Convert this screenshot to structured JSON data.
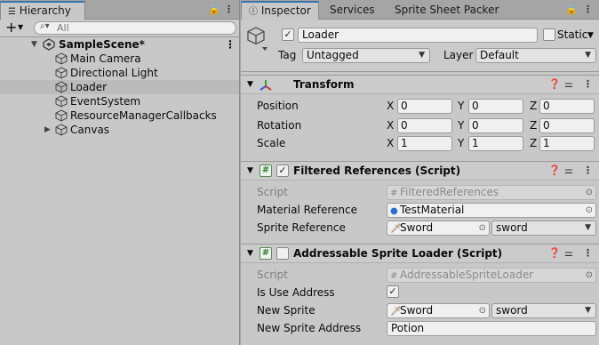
{
  "hierarchy": {
    "tab_label": "Hierarchy",
    "search_placeholder": "All",
    "scene": "SampleScene*",
    "items": [
      {
        "label": "Main Camera"
      },
      {
        "label": "Directional Light"
      },
      {
        "label": "Loader",
        "selected": true
      },
      {
        "label": "EventSystem"
      },
      {
        "label": "ResourceManagerCallbacks"
      },
      {
        "label": "Canvas",
        "collapsed": true
      }
    ]
  },
  "inspector": {
    "tabs": [
      "Inspector",
      "Services",
      "Sprite Sheet Packer"
    ],
    "object": {
      "name": "Loader",
      "active": true,
      "static_label": "Static",
      "tag_label": "Tag",
      "tag_value": "Untagged",
      "layer_label": "Layer",
      "layer_value": "Default"
    },
    "transform": {
      "title": "Transform",
      "rows": [
        {
          "label": "Position",
          "x": "0",
          "y": "0",
          "z": "0"
        },
        {
          "label": "Rotation",
          "x": "0",
          "y": "0",
          "z": "0"
        },
        {
          "label": "Scale",
          "x": "1",
          "y": "1",
          "z": "1"
        }
      ],
      "axis": [
        "X",
        "Y",
        "Z"
      ]
    },
    "filtered": {
      "title": "Filtered References (Script)",
      "script_label": "Script",
      "script_value": "FilteredReferences",
      "material_label": "Material Reference",
      "material_value": "TestMaterial",
      "sprite_label": "Sprite Reference",
      "sprite_value": "Sword",
      "sprite_sub": "sword"
    },
    "addressable": {
      "title": "Addressable Sprite Loader (Script)",
      "script_label": "Script",
      "script_value": "AddressableSpriteLoader",
      "use_address_label": "Is Use Address",
      "use_address": true,
      "new_sprite_label": "New Sprite",
      "new_sprite_value": "Sword",
      "new_sprite_sub": "sword",
      "address_label": "New Sprite Address",
      "address_value": "Potion"
    }
  },
  "colors": {
    "panel": "#c8c8c8",
    "tab_accent": "#3a72b0",
    "selection": "#bbbbbb"
  }
}
